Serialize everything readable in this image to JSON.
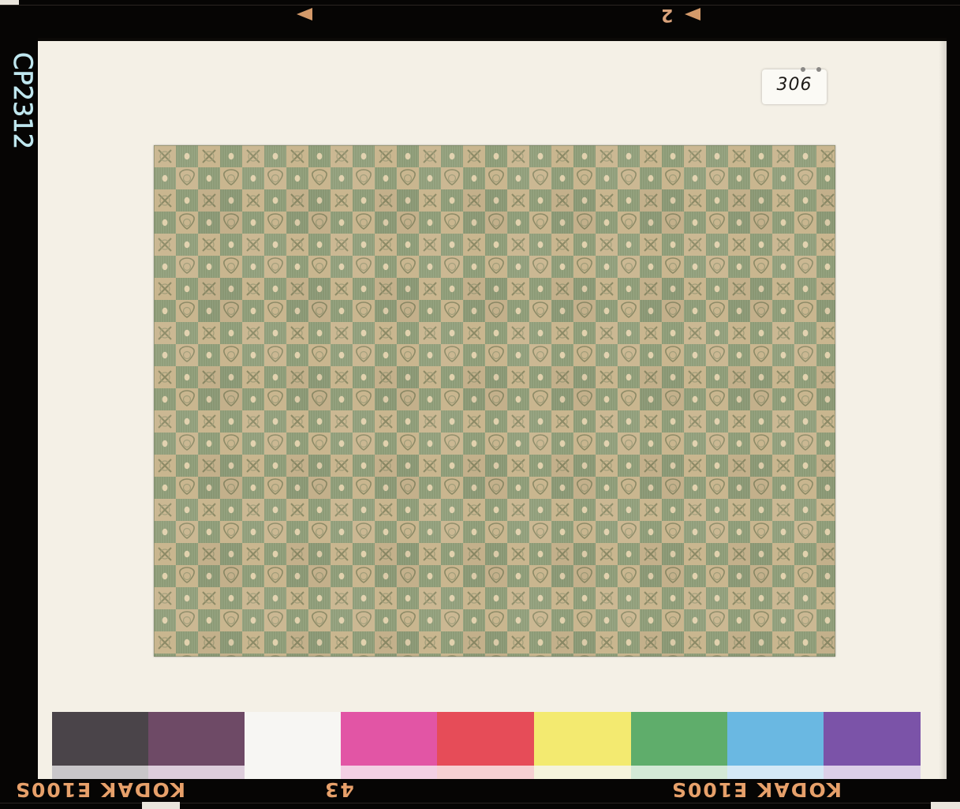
{
  "image": {
    "description_kind": "photograph of a mounted textile swatch on film",
    "film_edge": {
      "brand_text_left": "KODAK E100S",
      "brand_text_right": "KODAK E100S",
      "frame_number": "43",
      "top_number": "2",
      "handwritten_code": "CP2312"
    },
    "mount_label": "306",
    "colors": {
      "film_black": "#060504",
      "mount": "#f4f0e6",
      "fabric_green": "#8c9a76",
      "fabric_gold": "#c8b48c",
      "edge_orange": "#e7a06a"
    },
    "color_bar": [
      {
        "name": "gray",
        "main": "#4a4449",
        "lower": "#c9c6c9"
      },
      {
        "name": "purple",
        "main": "#6e4a66",
        "lower": "#ddcddb"
      },
      {
        "name": "white",
        "main": "#f7f6f3",
        "lower": "#f7f6f3"
      },
      {
        "name": "magenta",
        "main": "#e255a5",
        "lower": "#f3d0e4"
      },
      {
        "name": "red",
        "main": "#e64c58",
        "lower": "#f6d0d2"
      },
      {
        "name": "yellow",
        "main": "#f3ea70",
        "lower": "#f5f3dc"
      },
      {
        "name": "green",
        "main": "#5fad6b",
        "lower": "#d3e9d6"
      },
      {
        "name": "cyan",
        "main": "#6ab8e2",
        "lower": "#d4e9f6"
      },
      {
        "name": "violet",
        "main": "#7b53a8",
        "lower": "#dccfe8"
      }
    ]
  }
}
